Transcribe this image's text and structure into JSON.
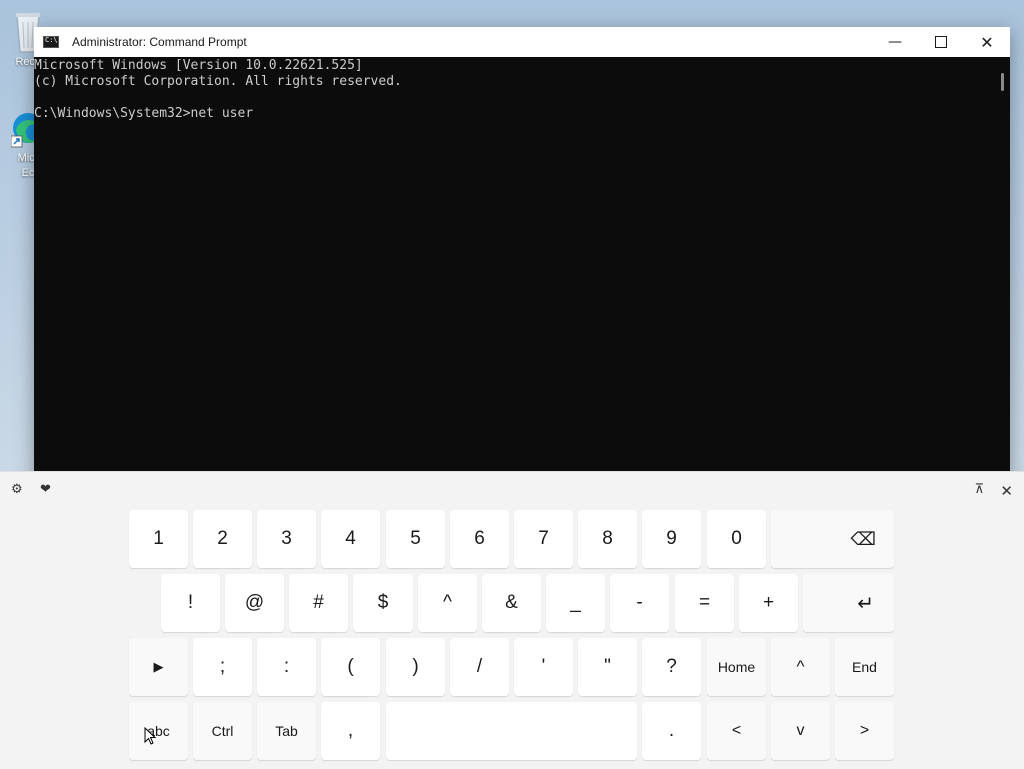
{
  "desktop": {
    "recycle_label": "Recy",
    "edge_label_1": "Micr",
    "edge_label_2": "Ec"
  },
  "window": {
    "title": "Administrator: Command Prompt",
    "icon": "cmd-icon",
    "console_lines": [
      "Microsoft Windows [Version 10.0.22621.525]",
      "(c) Microsoft Corporation. All rights reserved.",
      "",
      "C:\\Windows\\System32>net user"
    ],
    "min_glyph": "—",
    "close_glyph": "✕"
  },
  "keyboard": {
    "settings_glyph": "⚙",
    "emoji_glyph": "❤",
    "dock_glyph": "⊼",
    "close_glyph": "✕",
    "row1": [
      "1",
      "2",
      "3",
      "4",
      "5",
      "6",
      "7",
      "8",
      "9",
      "0"
    ],
    "backspace_glyph": "⌫",
    "row2": [
      "!",
      "@",
      "#",
      "$",
      "^",
      "&",
      "_",
      "-",
      "=",
      "+"
    ],
    "enter_glyph": "↵",
    "row3_play_glyph": "▶",
    "row3": [
      ";",
      ":",
      "(",
      ")",
      "/",
      "'",
      "\"",
      "?"
    ],
    "home_label": "Home",
    "up_glyph": "^",
    "end_label": "End",
    "abc_label": "abc",
    "ctrl_label": "Ctrl",
    "tab_label": "Tab",
    "comma": ",",
    "period": ".",
    "left_glyph": "<",
    "down_glyph": "v",
    "right_glyph": ">"
  },
  "colors": {
    "console_bg": "#0c0c0c",
    "console_fg": "#cccccc",
    "keyboard_bg": "#f3f3f3",
    "key_bg": "#ffffff"
  }
}
